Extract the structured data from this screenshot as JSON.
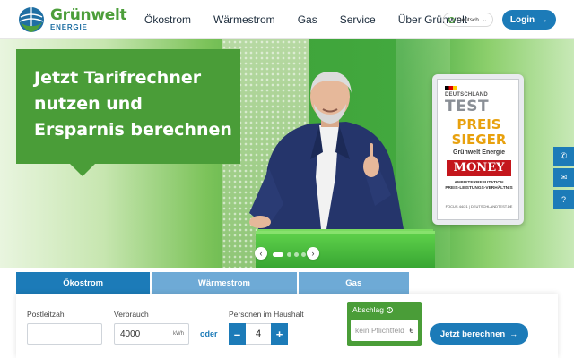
{
  "brand": {
    "name": "Grünwelt",
    "sub": "ENERGIE"
  },
  "nav": {
    "items": [
      "Ökostrom",
      "Wärmestrom",
      "Gas",
      "Service",
      "Über Grünwelt"
    ]
  },
  "language": {
    "selected": "Deutsch"
  },
  "login": {
    "label": "Login"
  },
  "hero": {
    "headline_lines": [
      "Jetzt Tarifrechner",
      "nutzen und",
      "Ersparnis berechnen"
    ]
  },
  "seal": {
    "country": "DEUTSCHLAND",
    "test": "TEST",
    "award_line1": "PREIS",
    "award_line2": "SIEGER",
    "company": "Grünwelt Energie",
    "magazine": "MONEY",
    "category_line1": "ANBIETERREPUTATION",
    "category_line2": "PREIS-LEISTUNGS-VERHÄLTNIS",
    "footer": "FOCUS 44/21 | DEUTSCHLANDTEST.DE"
  },
  "carousel": {
    "active_index": 0,
    "count": 4
  },
  "calculator": {
    "tabs": [
      {
        "label": "Ökostrom",
        "active": true
      },
      {
        "label": "Wärmestrom",
        "active": false
      },
      {
        "label": "Gas",
        "active": false
      }
    ],
    "postcode_label": "Postleitzahl",
    "postcode_value": "",
    "usage_label": "Verbrauch",
    "usage_value": "4000",
    "usage_unit": "kWh",
    "or_label": "oder",
    "persons_label": "Personen im Haushalt",
    "persons_value": "4",
    "minus": "–",
    "plus": "+",
    "installment_label": "Abschlag",
    "installment_placeholder": "kein Pflichtfeld",
    "currency": "€",
    "submit_label": "Jetzt berechnen"
  },
  "colors": {
    "brand_green": "#4a9d38",
    "brand_blue": "#1c7bb8"
  }
}
